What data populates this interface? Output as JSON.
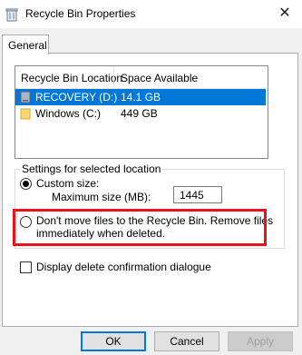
{
  "window": {
    "title": "Recycle Bin Properties",
    "close_glyph": "✕"
  },
  "tabs": [
    {
      "label": "General",
      "selected": true
    }
  ],
  "location_list": {
    "columns": [
      "Recycle Bin Location",
      "Space Available"
    ],
    "rows": [
      {
        "location": "RECOVERY (D:)",
        "space": "14.1 GB",
        "selected": true,
        "icon": "drive-icon"
      },
      {
        "location": "Windows (C:)",
        "space": "449 GB",
        "selected": false,
        "icon": "folder-icon"
      }
    ]
  },
  "settings": {
    "group_label": "Settings for selected location",
    "custom_size_label": "Custom size:",
    "custom_size_selected": true,
    "max_size_label": "Maximum size (MB):",
    "max_size_value": "1445",
    "dont_move_line1": "Don't move files to the Recycle Bin. Remove files",
    "dont_move_line2": "immediately when deleted.",
    "dont_move_selected": false
  },
  "confirm_checkbox": {
    "label": "Display delete confirmation dialogue",
    "checked": false
  },
  "buttons": {
    "ok": "OK",
    "cancel": "Cancel",
    "apply": "Apply"
  },
  "colors": {
    "highlight_box": "#e8131c",
    "selection": "#0078d7",
    "folder": "#f8d775"
  }
}
